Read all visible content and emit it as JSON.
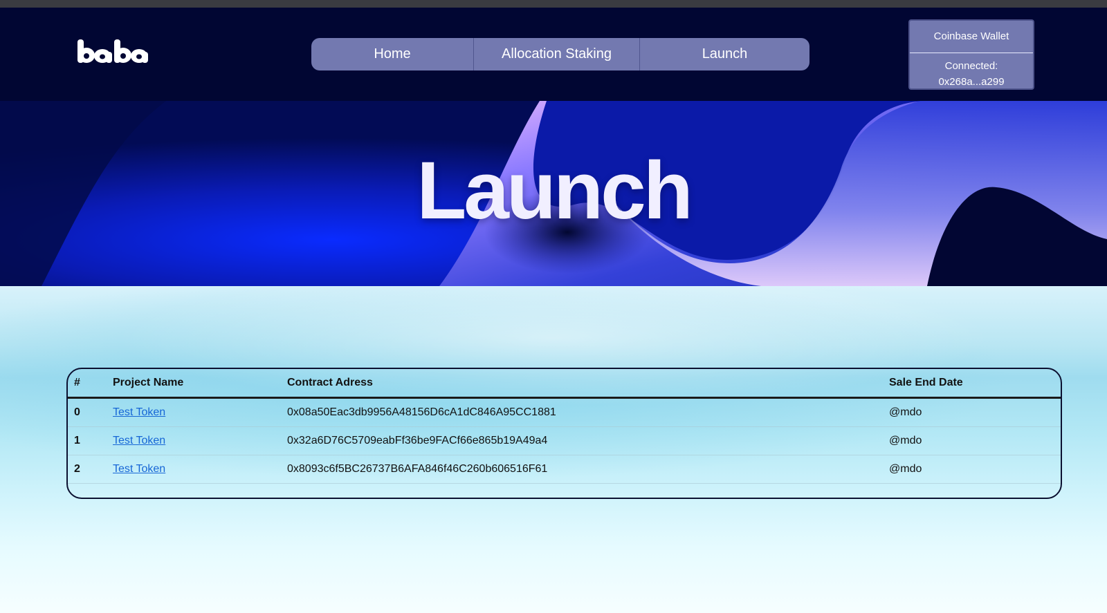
{
  "header": {
    "logo_text": "baba",
    "nav": [
      {
        "label": "Home"
      },
      {
        "label": "Allocation Staking"
      },
      {
        "label": "Launch"
      }
    ],
    "wallet": {
      "name": "Coinbase Wallet",
      "status": "Connected:",
      "address": "0x268a...a299"
    }
  },
  "hero": {
    "title": "Launch"
  },
  "table": {
    "columns": [
      "#",
      "Project Name",
      "Contract Adress",
      "Sale End Date"
    ],
    "rows": [
      {
        "index": "0",
        "project": "Test Token",
        "contract": "0x08a50Eac3db9956A48156D6cA1dC846A95CC1881",
        "end": "@mdo"
      },
      {
        "index": "1",
        "project": "Test Token",
        "contract": "0x32a6D76C5709eabFf36be9FACf66e865b19A49a4",
        "end": "@mdo"
      },
      {
        "index": "2",
        "project": "Test Token",
        "contract": "0x8093c6f5BC26737B6AFA846f46C260b606516F61",
        "end": "@mdo"
      }
    ]
  },
  "colors": {
    "header_bg": "#010633",
    "nav_bg": "#7379b0",
    "link": "#1666d6"
  }
}
